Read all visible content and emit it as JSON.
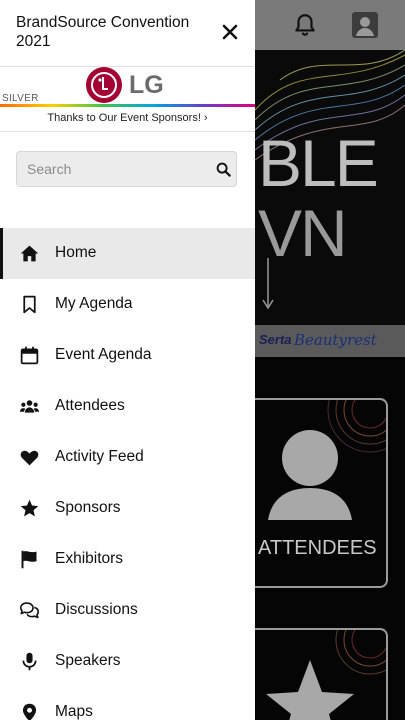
{
  "drawer": {
    "title": "BrandSource Convention 2021",
    "banner": {
      "tier": "SILVER",
      "sponsor": "LG",
      "thanks": "Thanks to Our Event Sponsors! ›"
    },
    "search": {
      "placeholder": "Search",
      "value": ""
    },
    "menu": [
      {
        "label": "Home",
        "icon": "home-icon",
        "active": true
      },
      {
        "label": "My Agenda",
        "icon": "bookmark-icon",
        "active": false
      },
      {
        "label": "Event Agenda",
        "icon": "calendar-icon",
        "active": false
      },
      {
        "label": "Attendees",
        "icon": "people-icon",
        "active": false
      },
      {
        "label": "Activity Feed",
        "icon": "heart-icon",
        "active": false
      },
      {
        "label": "Sponsors",
        "icon": "star-icon",
        "active": false
      },
      {
        "label": "Exhibitors",
        "icon": "flag-icon",
        "active": false
      },
      {
        "label": "Discussions",
        "icon": "chat-icon",
        "active": false
      },
      {
        "label": "Speakers",
        "icon": "microphone-icon",
        "active": false
      },
      {
        "label": "Maps",
        "icon": "map-pin-icon",
        "active": false
      }
    ]
  },
  "background": {
    "hero_line1": "BLE",
    "hero_line2": "VN",
    "sponsor_a": "Serta",
    "sponsor_b": "Beautyrest",
    "tile_attendees": "ATTENDEES"
  },
  "colors": {
    "lg_red": "#a50034",
    "active_bg": "#e9e9e9",
    "overlay": "#7a7a7a"
  }
}
